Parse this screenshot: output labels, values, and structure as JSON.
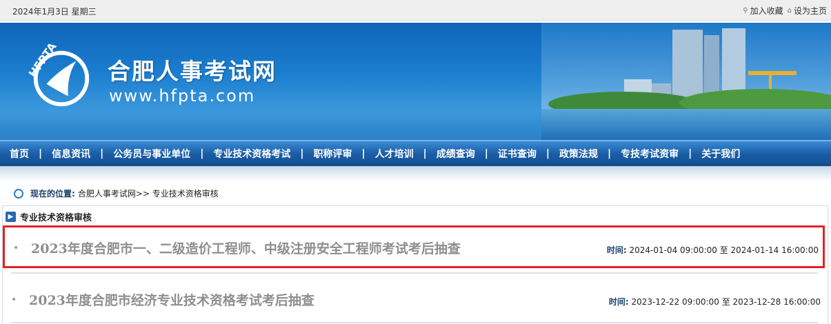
{
  "topbar": {
    "date": "2024年1月3日 星期三",
    "favorite_label": "加入收藏",
    "homepage_label": "设为主页"
  },
  "banner": {
    "logo_text": "HFPTA",
    "site_title": "合肥人事考试网",
    "site_url": "www.hfpta.com"
  },
  "nav": {
    "items": [
      "首页",
      "信息资讯",
      "公务员与事业单位",
      "专业技术资格考试",
      "职称评审",
      "人才培训",
      "成绩查询",
      "证书查询",
      "政策法规",
      "专技考试资审",
      "关于我们"
    ]
  },
  "breadcrumb": {
    "prefix": "现在的位置:",
    "path": "合肥人事考试网>> 专业技术资格审核"
  },
  "panel": {
    "heading": "专业技术资格审核",
    "rows": [
      {
        "title": "2023年度合肥市一、二级造价工程师、中级注册安全工程师考试考后抽查",
        "time_label": "时间:",
        "time_range": "2024-01-04 09:00:00 至 2024-01-14 16:00:00"
      },
      {
        "title": "2023年度合肥市经济专业技术资格考试考后抽查",
        "time_label": "时间:",
        "time_range": "2023-12-22 09:00:00 至 2023-12-28 16:00:00"
      }
    ]
  },
  "colors": {
    "nav_bg": "#1b5fa8",
    "banner_bg": "#1c7fd0",
    "highlight_border": "#e1222a"
  }
}
